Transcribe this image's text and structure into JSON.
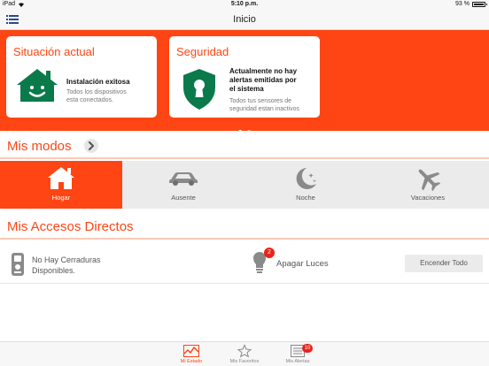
{
  "status_bar": {
    "device": "iPad",
    "time": "5:10 p.m.",
    "battery": "93 %"
  },
  "navbar": {
    "title": "Inicio"
  },
  "colors": {
    "accent": "#ff4513",
    "card_green": "#0a7a4a",
    "badge_red": "#e8231a"
  },
  "cards": [
    {
      "title": "Situación actual",
      "icon": "home-icon",
      "headline": "Instalación exitosa",
      "body_lines": [
        "Todos los dispositivos",
        "esta conectados."
      ]
    },
    {
      "title": "Seguridad",
      "icon": "shield-lock-icon",
      "headline_lines": [
        "Actualmente no hay",
        "alertas emitidas por",
        "el sistema"
      ],
      "body_lines": [
        "Todos tus sensores de",
        "seguridad estan inactivos"
      ]
    }
  ],
  "modes_section": {
    "title": "Mis modos",
    "items": [
      {
        "label": "Hogar",
        "icon": "house-icon",
        "active": true
      },
      {
        "label": "Ausente",
        "icon": "car-icon",
        "active": false
      },
      {
        "label": "Noche",
        "icon": "moon-icon",
        "active": false
      },
      {
        "label": "Vacaciones",
        "icon": "airplane-icon",
        "active": false
      }
    ]
  },
  "shortcuts_section": {
    "title": "Mis Accesos Directos",
    "locks_lines": [
      "No Hay Cerraduras",
      "Disponibles."
    ],
    "lights_badge": "2",
    "lights_label": "Apagar Luces",
    "lights_button": "Encender Todo"
  },
  "tabbar": {
    "items": [
      {
        "label": "Mi Estado",
        "icon": "pulse-chart-icon",
        "active": true
      },
      {
        "label": "Mis Favoritos",
        "icon": "star-icon",
        "active": false
      },
      {
        "label": "Mis Alertas",
        "icon": "alerts-list-icon",
        "active": false,
        "badge": "10"
      }
    ]
  }
}
